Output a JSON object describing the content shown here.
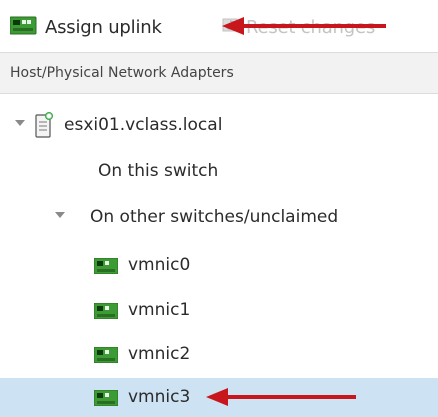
{
  "toolbar": {
    "assign_uplink_label": "Assign uplink",
    "reset_changes_label": "Reset changes",
    "assign_icon": "network-adapter-assign-icon",
    "reset_icon": "reset-icon"
  },
  "table": {
    "header": "Host/Physical Network Adapters"
  },
  "tree": {
    "host": {
      "label": "esxi01.vclass.local",
      "icon": "host-server-icon"
    },
    "groups": [
      {
        "label": "On this switch"
      },
      {
        "label": "On other switches/unclaimed"
      }
    ],
    "adapters": [
      {
        "label": "vmnic0",
        "icon": "network-adapter-icon",
        "selected": false
      },
      {
        "label": "vmnic1",
        "icon": "network-adapter-icon",
        "selected": false
      },
      {
        "label": "vmnic2",
        "icon": "network-adapter-icon",
        "selected": false
      },
      {
        "label": "vmnic3",
        "icon": "network-adapter-icon",
        "selected": true
      }
    ]
  },
  "colors": {
    "selection": "#cde3f4",
    "annotation_arrow": "#c8161d",
    "nic_green": "#3d9b35"
  }
}
